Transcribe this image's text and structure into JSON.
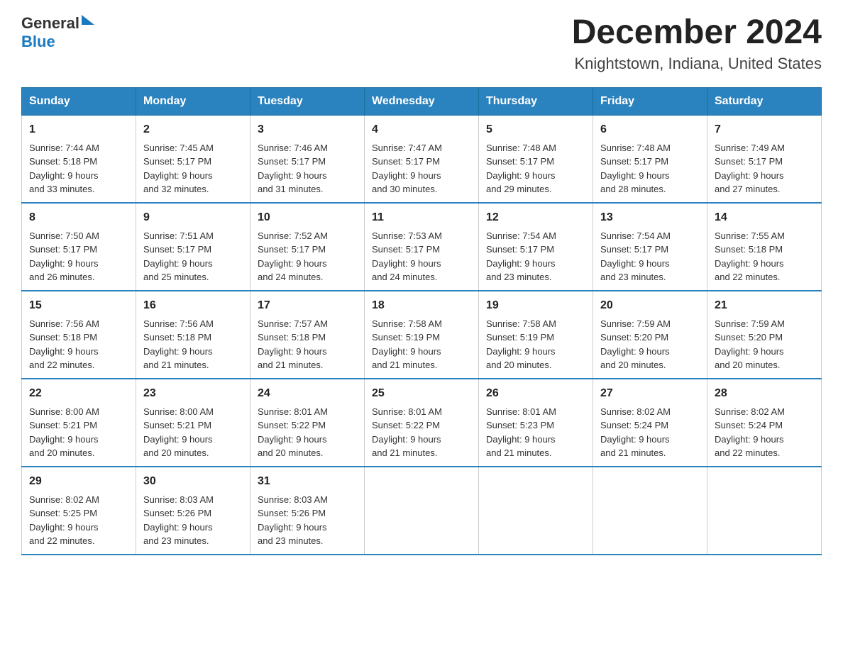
{
  "header": {
    "logo_general": "General",
    "logo_blue": "Blue",
    "title": "December 2024",
    "subtitle": "Knightstown, Indiana, United States"
  },
  "days_of_week": [
    "Sunday",
    "Monday",
    "Tuesday",
    "Wednesday",
    "Thursday",
    "Friday",
    "Saturday"
  ],
  "weeks": [
    [
      {
        "day": "1",
        "sunrise": "7:44 AM",
        "sunset": "5:18 PM",
        "daylight": "9 hours and 33 minutes."
      },
      {
        "day": "2",
        "sunrise": "7:45 AM",
        "sunset": "5:17 PM",
        "daylight": "9 hours and 32 minutes."
      },
      {
        "day": "3",
        "sunrise": "7:46 AM",
        "sunset": "5:17 PM",
        "daylight": "9 hours and 31 minutes."
      },
      {
        "day": "4",
        "sunrise": "7:47 AM",
        "sunset": "5:17 PM",
        "daylight": "9 hours and 30 minutes."
      },
      {
        "day": "5",
        "sunrise": "7:48 AM",
        "sunset": "5:17 PM",
        "daylight": "9 hours and 29 minutes."
      },
      {
        "day": "6",
        "sunrise": "7:48 AM",
        "sunset": "5:17 PM",
        "daylight": "9 hours and 28 minutes."
      },
      {
        "day": "7",
        "sunrise": "7:49 AM",
        "sunset": "5:17 PM",
        "daylight": "9 hours and 27 minutes."
      }
    ],
    [
      {
        "day": "8",
        "sunrise": "7:50 AM",
        "sunset": "5:17 PM",
        "daylight": "9 hours and 26 minutes."
      },
      {
        "day": "9",
        "sunrise": "7:51 AM",
        "sunset": "5:17 PM",
        "daylight": "9 hours and 25 minutes."
      },
      {
        "day": "10",
        "sunrise": "7:52 AM",
        "sunset": "5:17 PM",
        "daylight": "9 hours and 24 minutes."
      },
      {
        "day": "11",
        "sunrise": "7:53 AM",
        "sunset": "5:17 PM",
        "daylight": "9 hours and 24 minutes."
      },
      {
        "day": "12",
        "sunrise": "7:54 AM",
        "sunset": "5:17 PM",
        "daylight": "9 hours and 23 minutes."
      },
      {
        "day": "13",
        "sunrise": "7:54 AM",
        "sunset": "5:17 PM",
        "daylight": "9 hours and 23 minutes."
      },
      {
        "day": "14",
        "sunrise": "7:55 AM",
        "sunset": "5:18 PM",
        "daylight": "9 hours and 22 minutes."
      }
    ],
    [
      {
        "day": "15",
        "sunrise": "7:56 AM",
        "sunset": "5:18 PM",
        "daylight": "9 hours and 22 minutes."
      },
      {
        "day": "16",
        "sunrise": "7:56 AM",
        "sunset": "5:18 PM",
        "daylight": "9 hours and 21 minutes."
      },
      {
        "day": "17",
        "sunrise": "7:57 AM",
        "sunset": "5:18 PM",
        "daylight": "9 hours and 21 minutes."
      },
      {
        "day": "18",
        "sunrise": "7:58 AM",
        "sunset": "5:19 PM",
        "daylight": "9 hours and 21 minutes."
      },
      {
        "day": "19",
        "sunrise": "7:58 AM",
        "sunset": "5:19 PM",
        "daylight": "9 hours and 20 minutes."
      },
      {
        "day": "20",
        "sunrise": "7:59 AM",
        "sunset": "5:20 PM",
        "daylight": "9 hours and 20 minutes."
      },
      {
        "day": "21",
        "sunrise": "7:59 AM",
        "sunset": "5:20 PM",
        "daylight": "9 hours and 20 minutes."
      }
    ],
    [
      {
        "day": "22",
        "sunrise": "8:00 AM",
        "sunset": "5:21 PM",
        "daylight": "9 hours and 20 minutes."
      },
      {
        "day": "23",
        "sunrise": "8:00 AM",
        "sunset": "5:21 PM",
        "daylight": "9 hours and 20 minutes."
      },
      {
        "day": "24",
        "sunrise": "8:01 AM",
        "sunset": "5:22 PM",
        "daylight": "9 hours and 20 minutes."
      },
      {
        "day": "25",
        "sunrise": "8:01 AM",
        "sunset": "5:22 PM",
        "daylight": "9 hours and 21 minutes."
      },
      {
        "day": "26",
        "sunrise": "8:01 AM",
        "sunset": "5:23 PM",
        "daylight": "9 hours and 21 minutes."
      },
      {
        "day": "27",
        "sunrise": "8:02 AM",
        "sunset": "5:24 PM",
        "daylight": "9 hours and 21 minutes."
      },
      {
        "day": "28",
        "sunrise": "8:02 AM",
        "sunset": "5:24 PM",
        "daylight": "9 hours and 22 minutes."
      }
    ],
    [
      {
        "day": "29",
        "sunrise": "8:02 AM",
        "sunset": "5:25 PM",
        "daylight": "9 hours and 22 minutes."
      },
      {
        "day": "30",
        "sunrise": "8:03 AM",
        "sunset": "5:26 PM",
        "daylight": "9 hours and 23 minutes."
      },
      {
        "day": "31",
        "sunrise": "8:03 AM",
        "sunset": "5:26 PM",
        "daylight": "9 hours and 23 minutes."
      },
      null,
      null,
      null,
      null
    ]
  ],
  "labels": {
    "sunrise": "Sunrise:",
    "sunset": "Sunset:",
    "daylight": "Daylight:"
  }
}
